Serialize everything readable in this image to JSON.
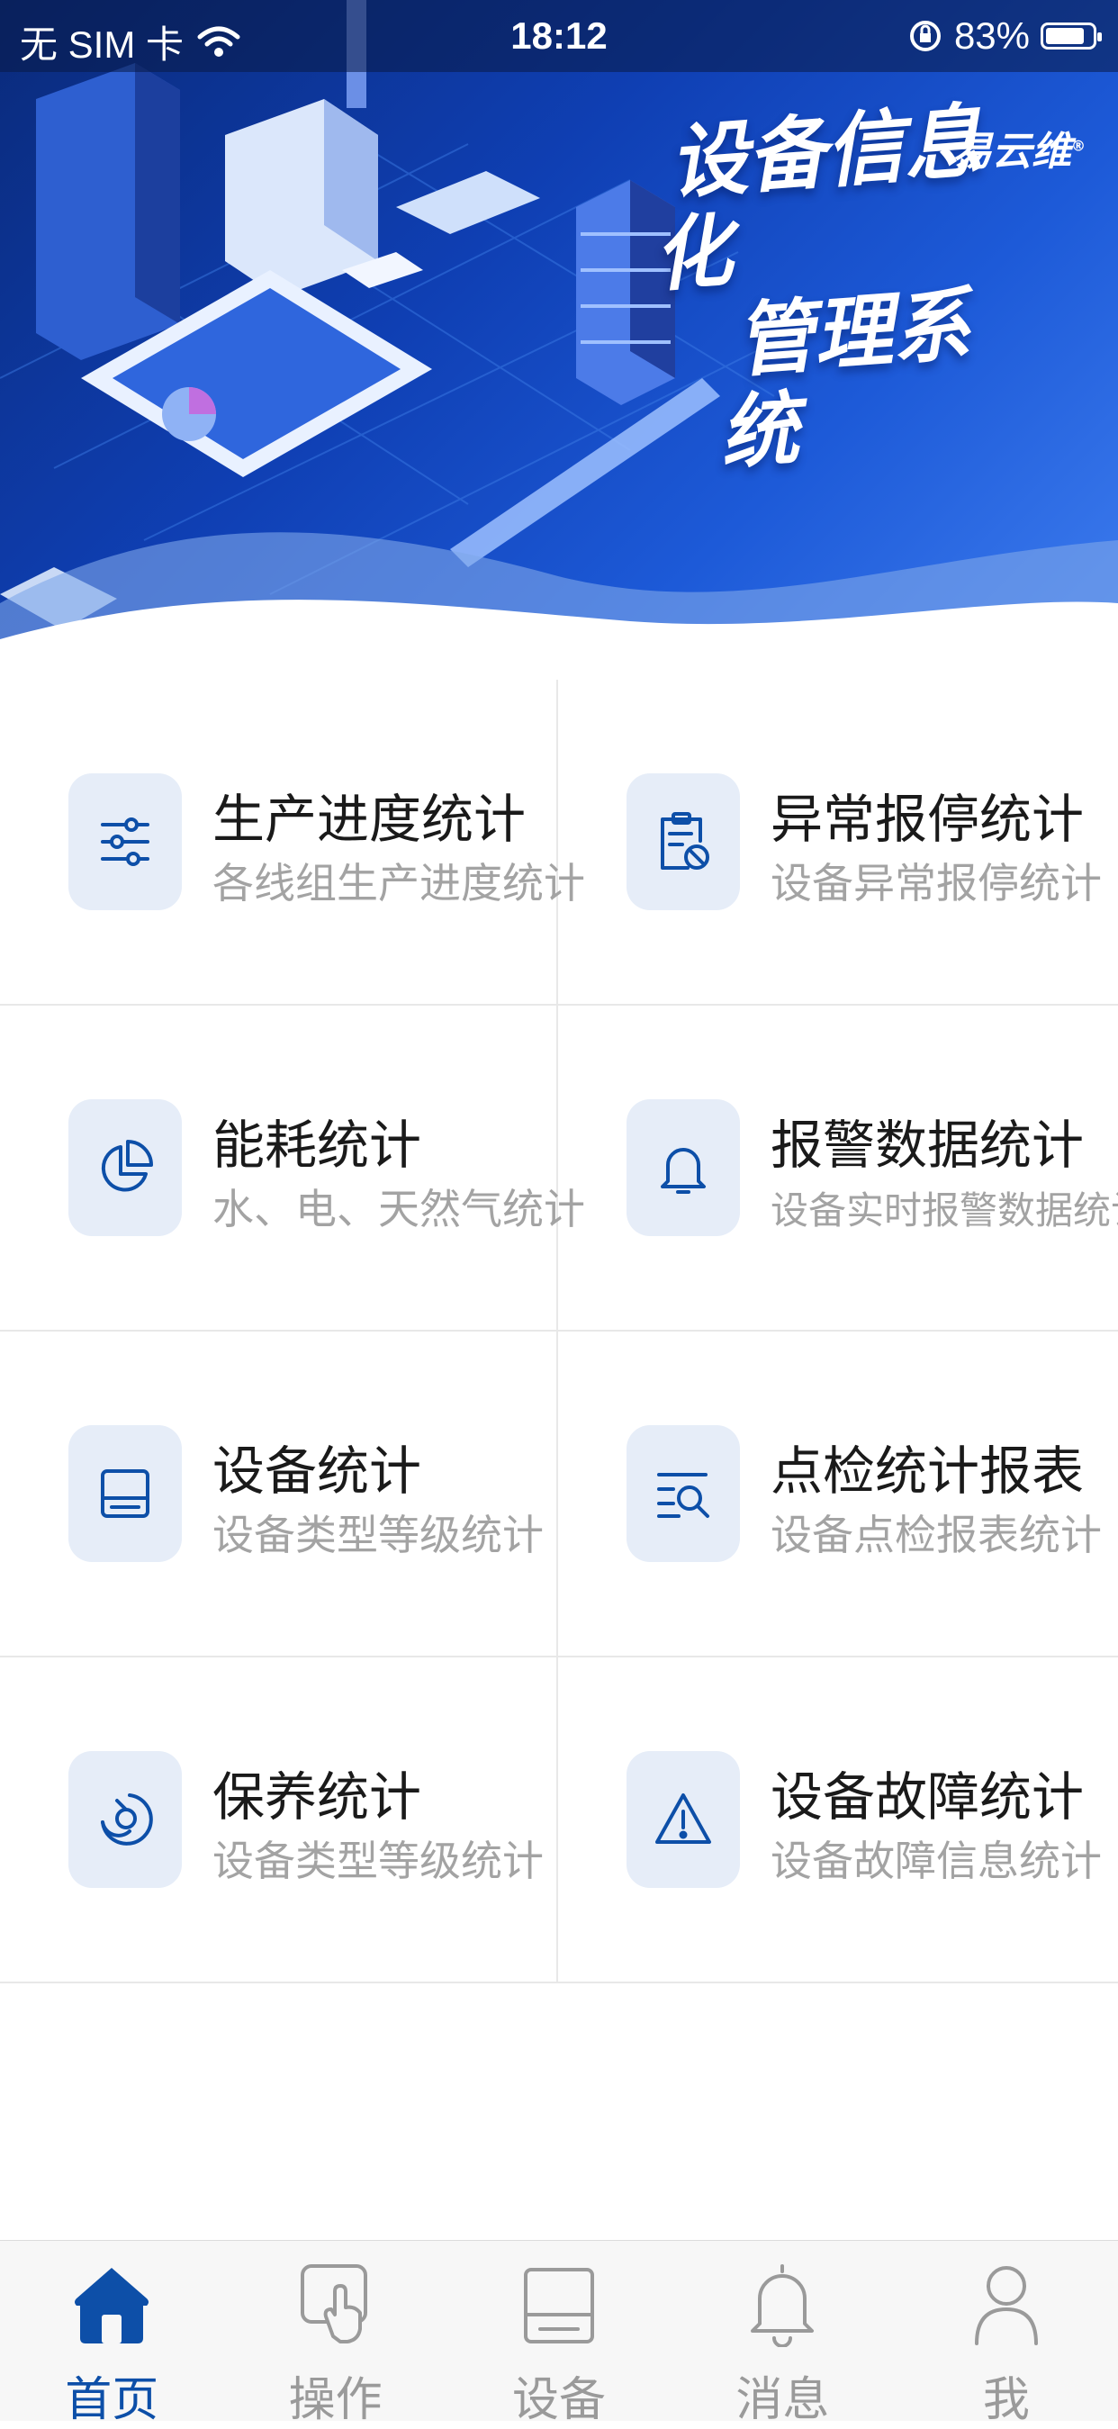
{
  "status_bar": {
    "carrier": "无 SIM 卡",
    "time": "18:12",
    "battery": "83%",
    "battery_level": 0.83
  },
  "banner": {
    "title_line1": "设备信息化",
    "title_line2": "管理系统",
    "logo": "易云维",
    "logo_mark": "®"
  },
  "menu": [
    {
      "title": "生产进度统计",
      "subtitle": "各线组生产进度统计",
      "icon": "sliders-icon"
    },
    {
      "title": "异常报停统计",
      "subtitle": "设备异常报停统计",
      "icon": "clipboard-stop-icon"
    },
    {
      "title": "能耗统计",
      "subtitle": "水、电、天然气统计",
      "icon": "pie-chart-icon"
    },
    {
      "title": "报警数据统计",
      "subtitle": "设备实时报警数据统计",
      "icon": "bell-icon"
    },
    {
      "title": "设备统计",
      "subtitle": "设备类型等级统计",
      "icon": "device-icon"
    },
    {
      "title": "点检统计报表",
      "subtitle": "设备点检报表统计",
      "icon": "list-search-icon"
    },
    {
      "title": "保养统计",
      "subtitle": "设备类型等级统计",
      "icon": "maintenance-icon"
    },
    {
      "title": "设备故障统计",
      "subtitle": "设备故障信息统计",
      "icon": "warning-icon"
    }
  ],
  "tabs": [
    {
      "label": "首页",
      "icon": "home-icon",
      "active": true
    },
    {
      "label": "操作",
      "icon": "touch-icon",
      "active": false
    },
    {
      "label": "设备",
      "icon": "device-icon",
      "active": false
    },
    {
      "label": "消息",
      "icon": "bell-icon",
      "active": false
    },
    {
      "label": "我",
      "icon": "user-icon",
      "active": false
    }
  ],
  "colors": {
    "accent": "#0d4fa8",
    "icon_bg": "#e6edf8",
    "tab_inactive": "#9a9a9a"
  }
}
